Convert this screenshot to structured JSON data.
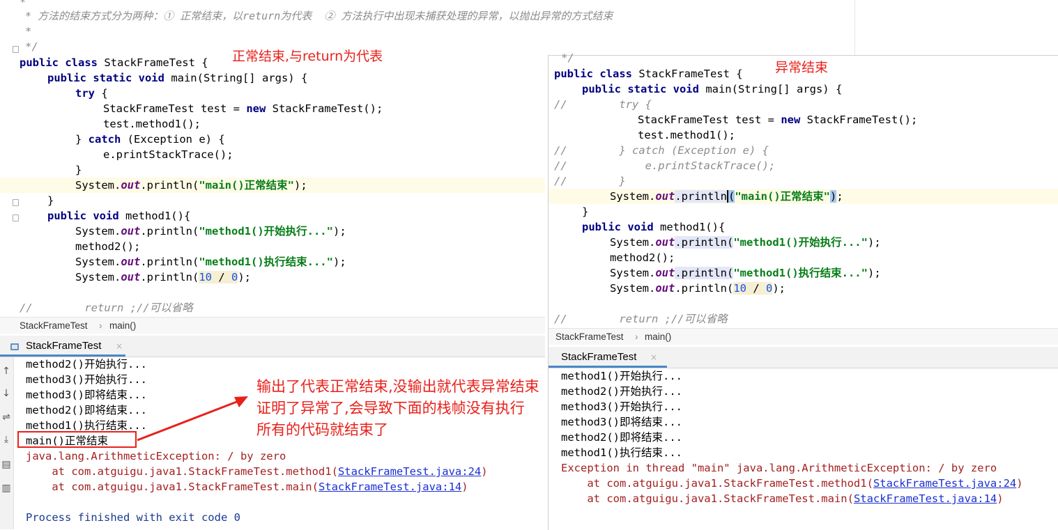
{
  "left": {
    "doc_lines": [
      "* 方法的结束方式分为两种：① 正常结束，以return为代表  ② 方法执行中出现未捕获处理的异常，以抛出异常的方式结束",
      "*",
      "*/"
    ],
    "code": {
      "l1_kw": "public class ",
      "l1_rest": "StackFrameTest {",
      "l2_kw": "public static void ",
      "l2_rest": "main(String[] args) {",
      "l3_kw": "try",
      "l3_rest": " {",
      "l4_a": "StackFrameTest test = ",
      "l4_kw": "new",
      "l4_b": " StackFrameTest();",
      "l5": "test.method1();",
      "l6_a": "} ",
      "l6_kw": "catch",
      "l6_b": " (Exception e) {",
      "l7": "e.printStackTrace();",
      "l8": "}",
      "l9_a": "System.",
      "l9_fld": "out",
      "l9_b": ".println(",
      "l9_str": "\"main()正常结束\"",
      "l9_c": ");",
      "l10": "}",
      "l11_kw": "public void ",
      "l11_rest": "method1(){",
      "l12_a": "System.",
      "l12_fld": "out",
      "l12_b": ".println(",
      "l12_str": "\"method1()开始执行...\"",
      "l12_c": ");",
      "l13": "method2();",
      "l14_a": "System.",
      "l14_fld": "out",
      "l14_b": ".println(",
      "l14_str": "\"method1()执行结束...\"",
      "l14_c": ");",
      "l15_a": "System.",
      "l15_fld": "out",
      "l15_b": ".println(",
      "l15_num1": "10",
      "l15_op": " / ",
      "l15_num2": "0",
      "l15_c": ");",
      "l16_cmt": "//        return ;//可以省略"
    },
    "breadcrumb": [
      "StackFrameTest",
      "main()"
    ],
    "run_tab": "StackFrameTest",
    "console": [
      "method2()开始执行...",
      "method3()开始执行...",
      "method3()即将结束...",
      "method2()即将结束...",
      "method1()执行结束...",
      "main()正常结束",
      "java.lang.ArithmeticException: / by zero"
    ],
    "trace1_pre": "    at com.atguigu.java1.StackFrameTest.method1(",
    "trace1_link": "StackFrameTest.java:24",
    "trace2_pre": "    at com.atguigu.java1.StackFrameTest.main(",
    "trace2_link": "StackFrameTest.java:14",
    "trace_post": ")",
    "process": "Process finished with exit code 0"
  },
  "right": {
    "code": {
      "l0": "*/",
      "l1_kw": "public class ",
      "l1_rest": "StackFrameTest {",
      "l2_kw": "public static void ",
      "l2_rest": "main(String[] args) {",
      "l3": "//        try {",
      "l4_a": "StackFrameTest test = ",
      "l4_kw": "new",
      "l4_b": " StackFrameTest();",
      "l5": "test.method1();",
      "l6": "//        } catch (Exception e) {",
      "l7": "//            e.printStackTrace();",
      "l8": "//        }",
      "l9_a": "System.",
      "l9_fld": "out",
      "l9_b": ".println",
      "l9_p1": "(",
      "l9_str": "\"main()正常结束\"",
      "l9_p2": ")",
      "l9_c": ";",
      "l10": "}",
      "l11_kw": "public void ",
      "l11_rest": "method1(){",
      "l12_a": "System.",
      "l12_fld": "out",
      "l12_b": ".println(",
      "l12_str": "\"method1()开始执行...\"",
      "l12_c": ");",
      "l13": "method2();",
      "l14_a": "System.",
      "l14_fld": "out",
      "l14_b": ".println(",
      "l14_str": "\"method1()执行结束...\"",
      "l14_c": ");",
      "l15_a": "System.",
      "l15_fld": "out",
      "l15_b": ".println(",
      "l15_num1": "10",
      "l15_op": " / ",
      "l15_num2": "0",
      "l15_c": ");",
      "l16_cmt": "//        return ;//可以省略"
    },
    "breadcrumb": [
      "StackFrameTest",
      "main()"
    ],
    "run_tab": "StackFrameTest",
    "console": [
      "method1()开始执行...",
      "method2()开始执行...",
      "method3()开始执行...",
      "method3()即将结束...",
      "method2()即将结束...",
      "method1()执行结束..."
    ],
    "exception": "Exception in thread \"main\" java.lang.ArithmeticException: / by zero",
    "trace1_pre": "    at com.atguigu.java1.StackFrameTest.method1(",
    "trace1_link": "StackFrameTest.java:24",
    "trace2_pre": "    at com.atguigu.java1.StackFrameTest.main(",
    "trace2_link": "StackFrameTest.java:14",
    "trace_post": ")"
  },
  "annotations": {
    "normal_end": "正常结束,与return为代表",
    "abnormal_end": "异常结束",
    "explain": [
      "输出了代表正常结束,没输出就代表异常结束",
      "证明了异常了,会导致下面的栈帧没有执行",
      "所有的代码就结束了"
    ]
  },
  "colors": {
    "annotation_red": "#e8211b",
    "keyword": "#000080",
    "string": "#067d17",
    "field": "#660e7a",
    "number": "#1750eb",
    "comment": "#8c8c8c",
    "link": "#1a2fd1",
    "error": "#a32020"
  }
}
